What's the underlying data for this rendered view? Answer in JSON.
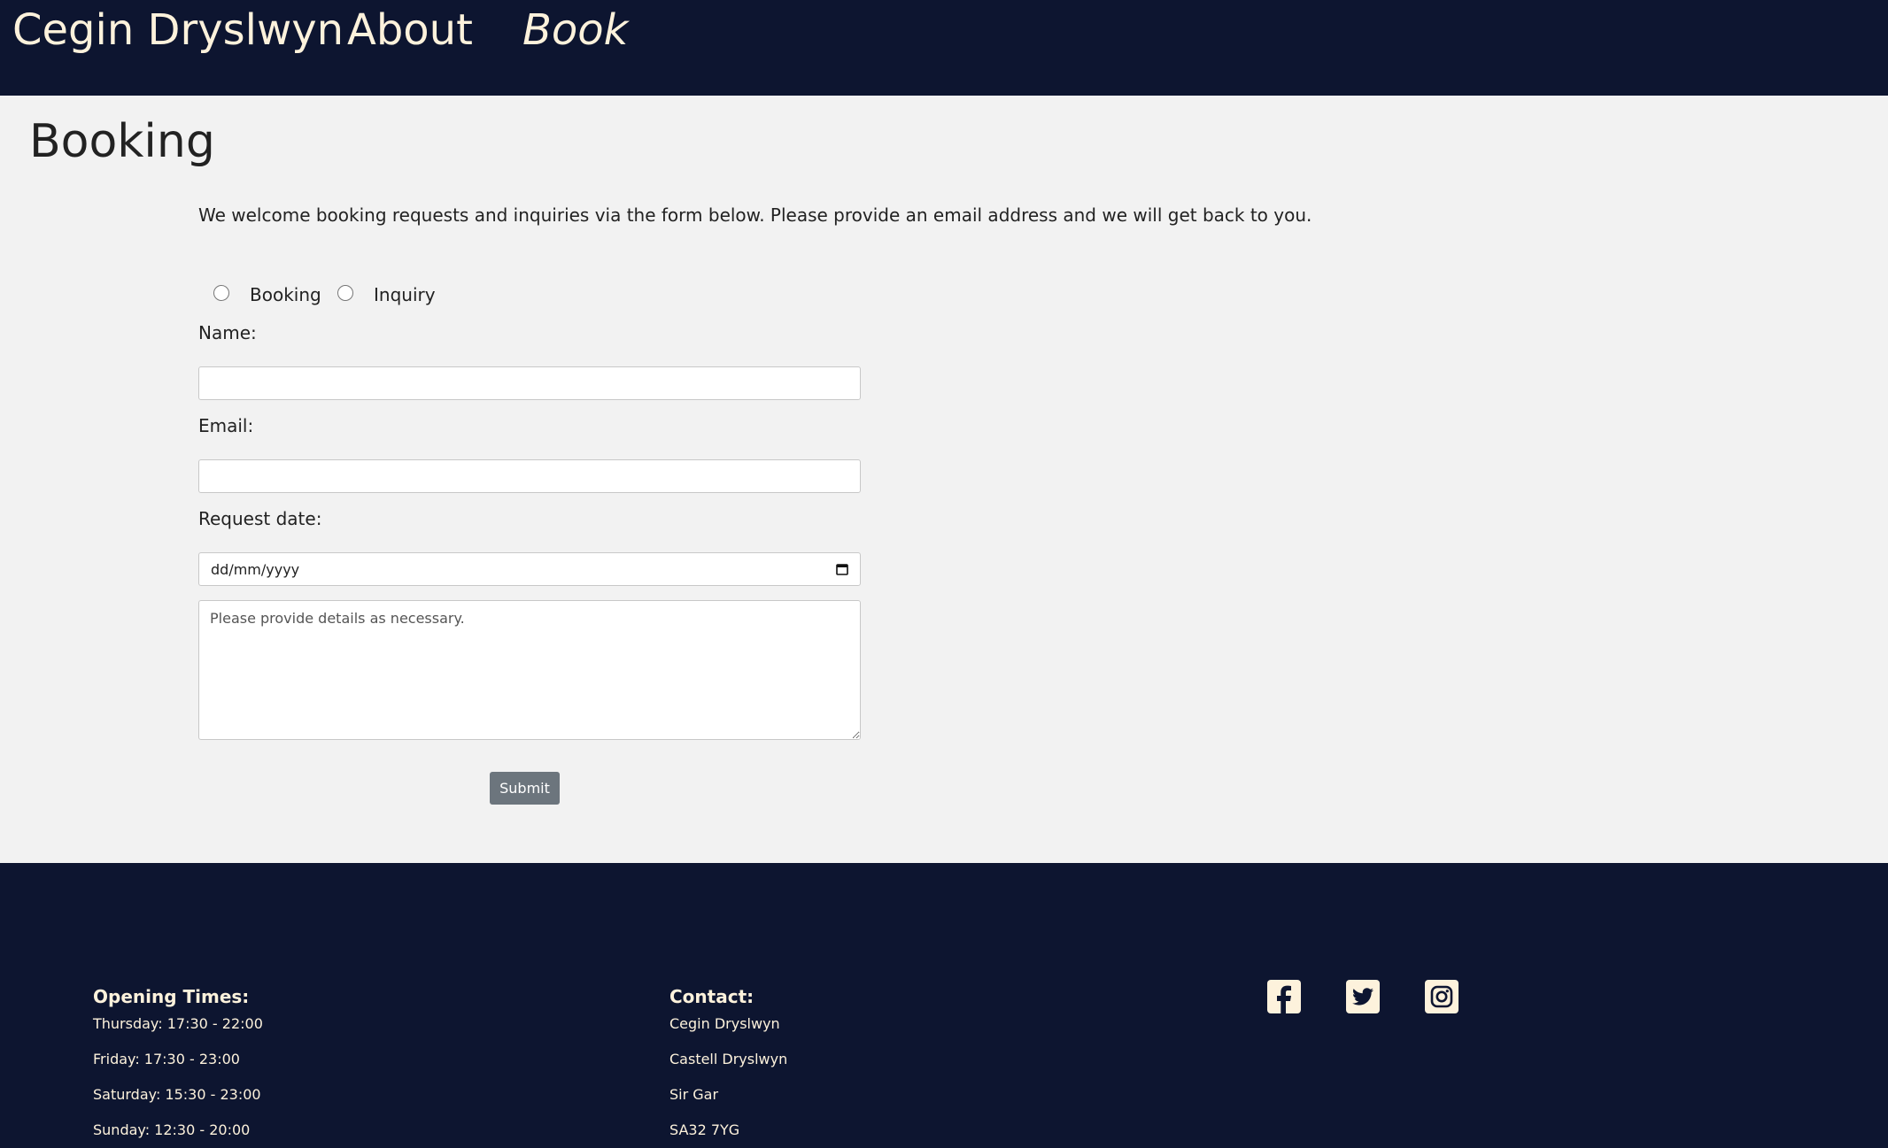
{
  "nav": {
    "brand": "Cegin Dryslwyn",
    "about": "About",
    "book": "Book"
  },
  "page": {
    "title": "Booking",
    "intro": "We welcome booking requests and inquiries via the form below. Please provide an email address and we will get back to you."
  },
  "form": {
    "radio_booking": "Booking",
    "radio_inquiry": "Inquiry",
    "name_label": "Name:",
    "email_label": "Email:",
    "date_label": "Request date:",
    "date_placeholder": "dd/mm/yyyy",
    "details_placeholder": "Please provide details as necessary.",
    "submit_label": "Submit"
  },
  "footer": {
    "opening": {
      "heading": "Opening Times:",
      "lines": [
        "Thursday: 17:30 - 22:00",
        "Friday: 17:30 - 23:00",
        "Saturday: 15:30 - 23:00",
        "Sunday: 12:30 - 20:00"
      ]
    },
    "contact": {
      "heading": "Contact:",
      "lines": [
        "Cegin Dryslwyn",
        "Castell Dryslwyn",
        "Sir Gar",
        "SA32 7YG"
      ]
    },
    "social_icons": [
      "facebook-icon",
      "twitter-icon",
      "instagram-icon"
    ]
  },
  "colors": {
    "header_bg": "#0d1530",
    "accent_text": "#fdf2dc",
    "page_bg": "#f2f2f2",
    "button_bg": "#6c757d"
  }
}
